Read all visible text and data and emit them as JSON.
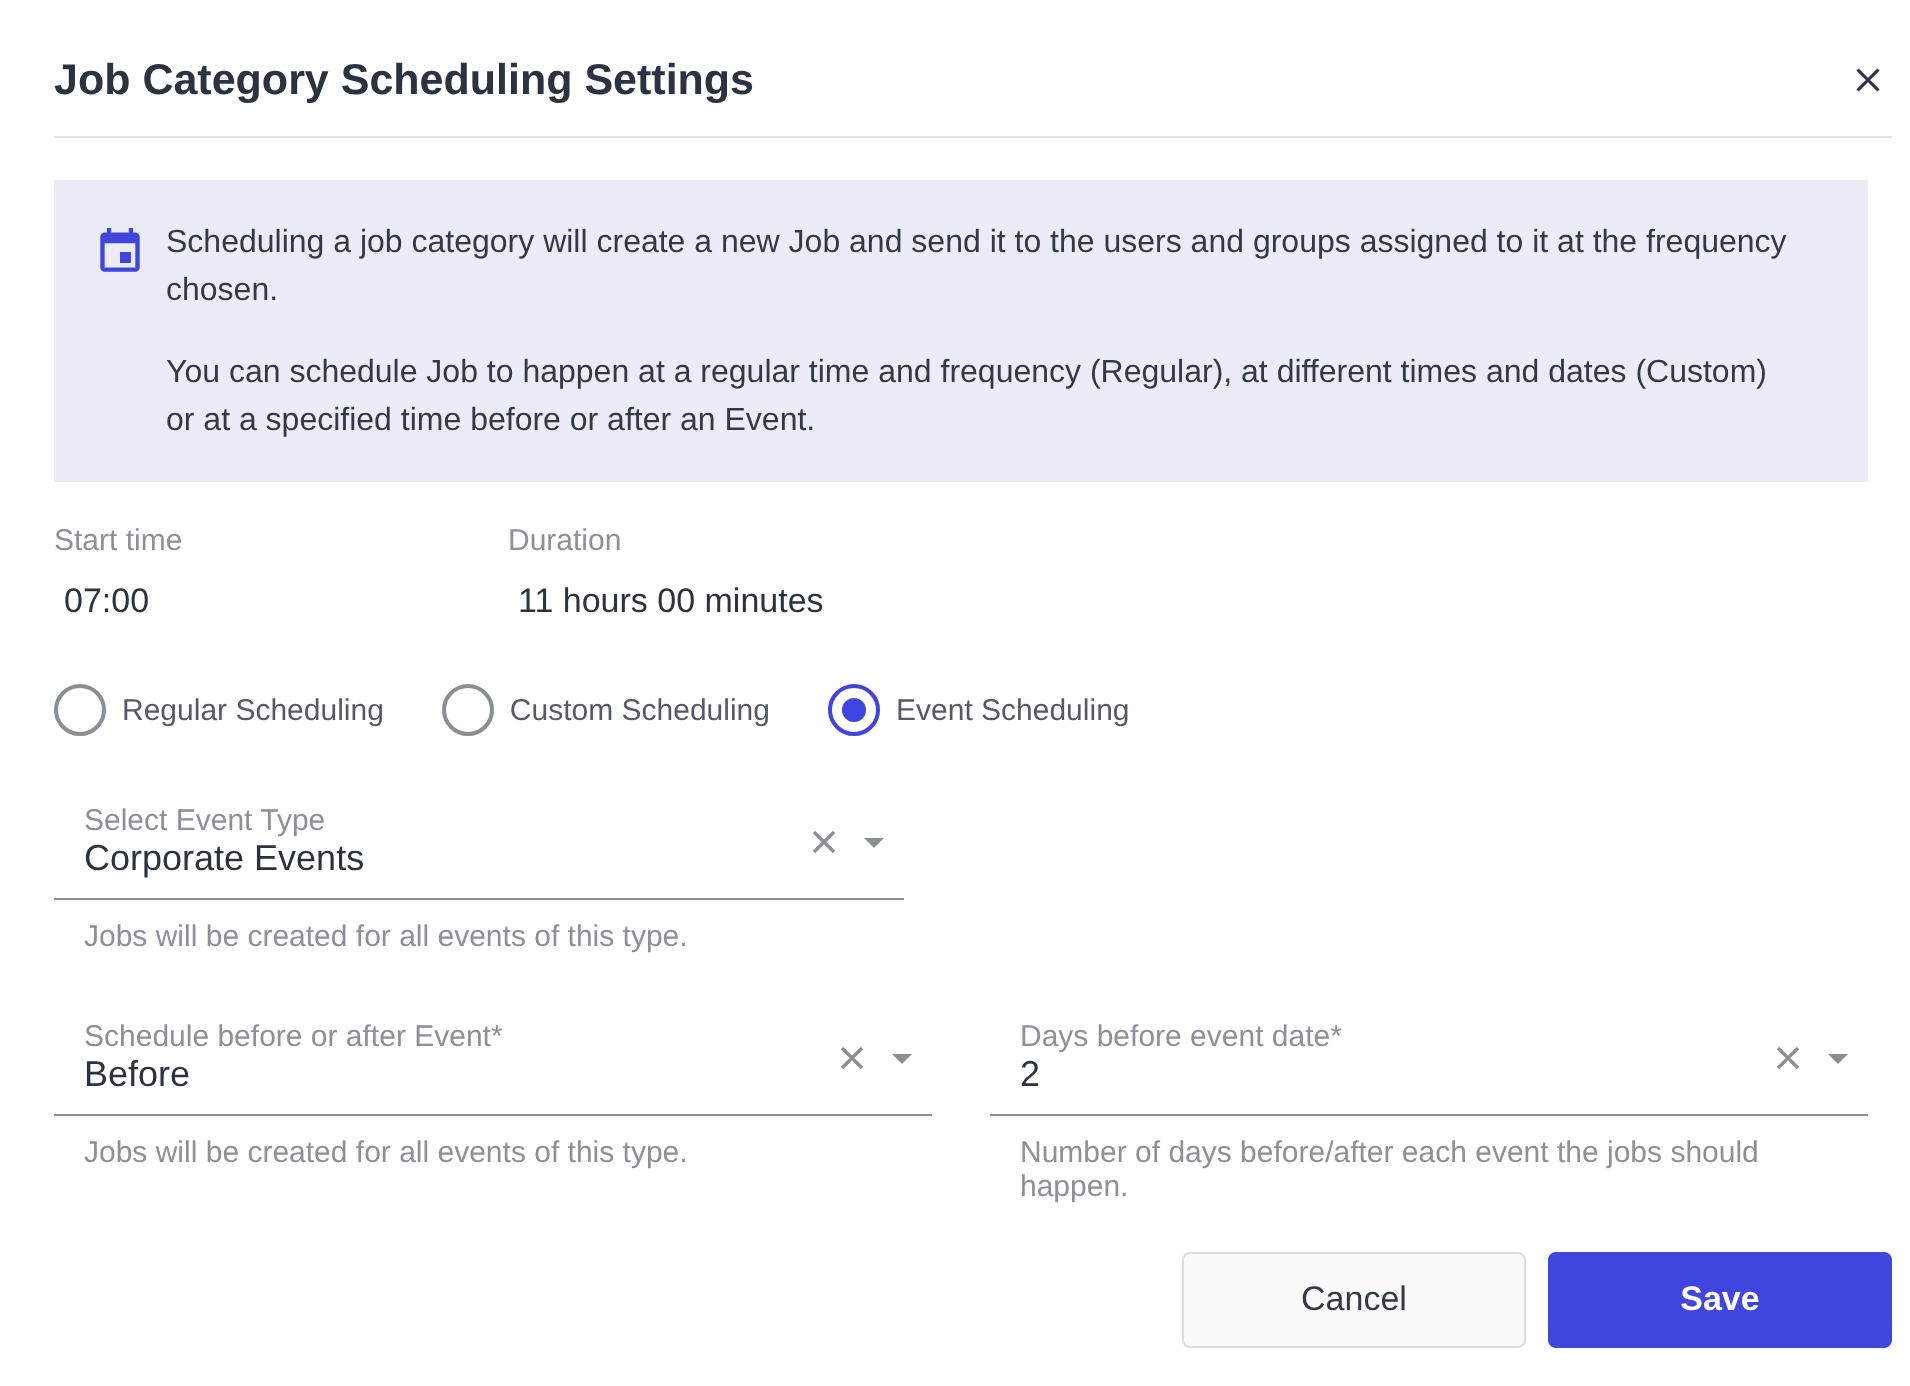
{
  "dialog": {
    "title": "Job Category Scheduling Settings"
  },
  "info": {
    "paragraphs": [
      "Scheduling a job category will create a new Job and send it to the users and groups assigned to it at the frequency chosen.",
      "You can schedule Job to happen at a regular time and frequency (Regular), at different times and dates (Custom) or at a specified time before or after an Event."
    ]
  },
  "summary": [
    {
      "label": "Start time",
      "value": "07:00"
    },
    {
      "label": "Duration",
      "value": "11 hours 00 minutes"
    }
  ],
  "schedule_types": [
    {
      "label": "Regular Scheduling",
      "selected": false
    },
    {
      "label": "Custom Scheduling",
      "selected": false
    },
    {
      "label": "Event Scheduling",
      "selected": true
    }
  ],
  "field_rows": [
    {
      "fields": [
        {
          "label": "Select Event Type",
          "value": "Corporate Events",
          "helper": "Jobs will be created for all events of this type."
        }
      ]
    },
    {
      "fields": [
        {
          "label": "Schedule before or after Event*",
          "value": "Before",
          "helper": "Jobs will be created for all events of this type."
        },
        {
          "label": "Days before event date*",
          "value": "2",
          "helper": "Number of days before/after each event the jobs should happen."
        }
      ]
    }
  ],
  "buttons": [
    {
      "label": "Cancel",
      "kind": "secondary"
    },
    {
      "label": "Save",
      "kind": "primary"
    }
  ]
}
